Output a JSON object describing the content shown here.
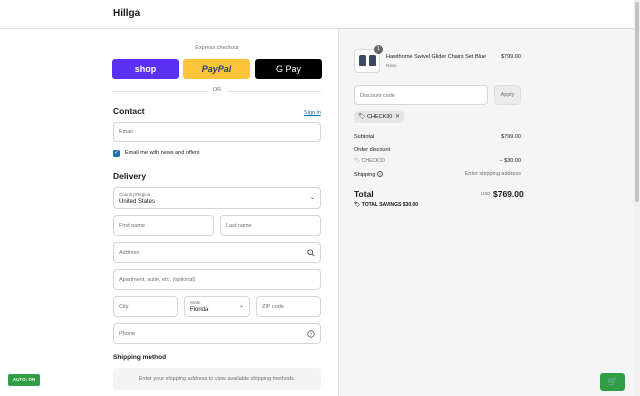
{
  "brand": "Hillga",
  "express": {
    "title": "Express checkout",
    "shop_label": "shop",
    "paypal_label": "PayPal",
    "gpay_label": "G Pay",
    "or": "OR"
  },
  "contact": {
    "title": "Contact",
    "sign_in": "Sign in",
    "email_placeholder": "Email",
    "news_label": "Email me with news and offers",
    "news_checked": true
  },
  "delivery": {
    "title": "Delivery",
    "country_label": "Country/Region",
    "country_value": "United States",
    "first_name": "First name",
    "last_name": "Last name",
    "address": "Address",
    "apartment": "Apartment, suite, etc. (optional)",
    "city": "City",
    "state_label": "State",
    "state_value": "Florida",
    "zip": "ZIP code",
    "phone": "Phone"
  },
  "shipping_method": {
    "title": "Shipping method",
    "notice": "Enter your shipping address to view available shipping methods."
  },
  "auto_button": "AUTO: ON",
  "summary": {
    "item": {
      "quantity": "1",
      "name": "Hawthorne Swivel Glider Chairs Set Blue",
      "variant": "Navy",
      "price": "$799.00"
    },
    "discount_placeholder": "Discount code",
    "apply_label": "Apply",
    "applied_code": "CHECK30",
    "subtotal_label": "Subtotal",
    "subtotal_value": "$799.00",
    "order_discount_label": "Order discount",
    "discount_code": "CHECK30",
    "discount_value": "− $30.00",
    "shipping_label": "Shipping",
    "shipping_value": "Enter shipping address",
    "total_label": "Total",
    "currency": "USD",
    "total_value": "$769.00",
    "savings_label": "TOTAL SAVINGS",
    "savings_value": "$30.00"
  },
  "colors": {
    "accent": "#1773b0",
    "shop": "#5a31f4",
    "paypal": "#ffc439",
    "auto": "#2f9e44"
  }
}
